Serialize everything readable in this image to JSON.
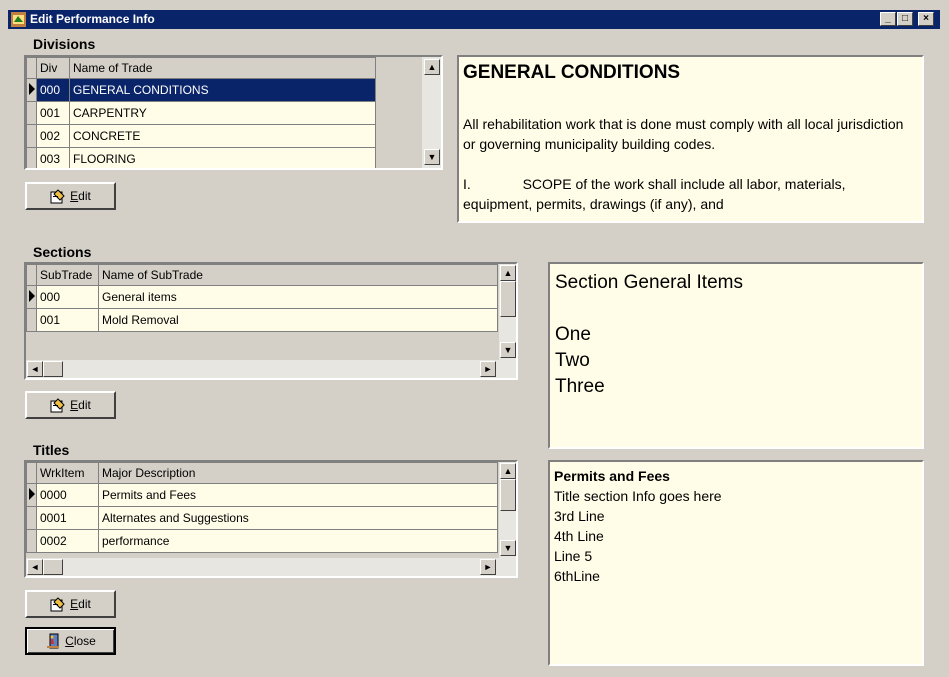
{
  "window": {
    "title": "Edit Performance Info"
  },
  "divisions": {
    "label": "Divisions",
    "columns": [
      "Div",
      "Name of Trade"
    ],
    "rows": [
      [
        "000",
        "GENERAL CONDITIONS"
      ],
      [
        "001",
        "CARPENTRY"
      ],
      [
        "002",
        "CONCRETE"
      ],
      [
        "003",
        "FLOORING"
      ]
    ],
    "edit_label": "Edit",
    "memo_title": "GENERAL CONDITIONS",
    "memo_p1": "All rehabilitation work that is done must comply with all local jurisdiction or governing municipality building codes.",
    "memo_p2_num": "I.",
    "memo_p2": "SCOPE of the work shall include all labor, materials, equipment, permits, drawings (if any), and"
  },
  "sections": {
    "label": "Sections",
    "columns": [
      "SubTrade",
      "Name of SubTrade"
    ],
    "rows": [
      [
        "000",
        "General items"
      ],
      [
        "001",
        "Mold Removal"
      ]
    ],
    "edit_label": "Edit",
    "memo_lines": [
      "Section General Items",
      "",
      "One",
      "Two",
      "Three"
    ]
  },
  "titles": {
    "label": "Titles",
    "columns": [
      "WrkItem",
      "Major Description"
    ],
    "rows": [
      [
        "0000",
        "Permits and Fees"
      ],
      [
        "0001",
        "Alternates and Suggestions"
      ],
      [
        "0002",
        "performance"
      ]
    ],
    "edit_label": "Edit",
    "close_label": "Close",
    "memo_title": "Permits and Fees",
    "memo_lines": [
      "Title section Info goes here",
      "3rd Line",
      "4th Line",
      "Line 5",
      "6thLine"
    ]
  },
  "colors": {
    "titlebar": "#0a246a",
    "memo_bg": "#fffde8",
    "face": "#d4d0c8"
  }
}
